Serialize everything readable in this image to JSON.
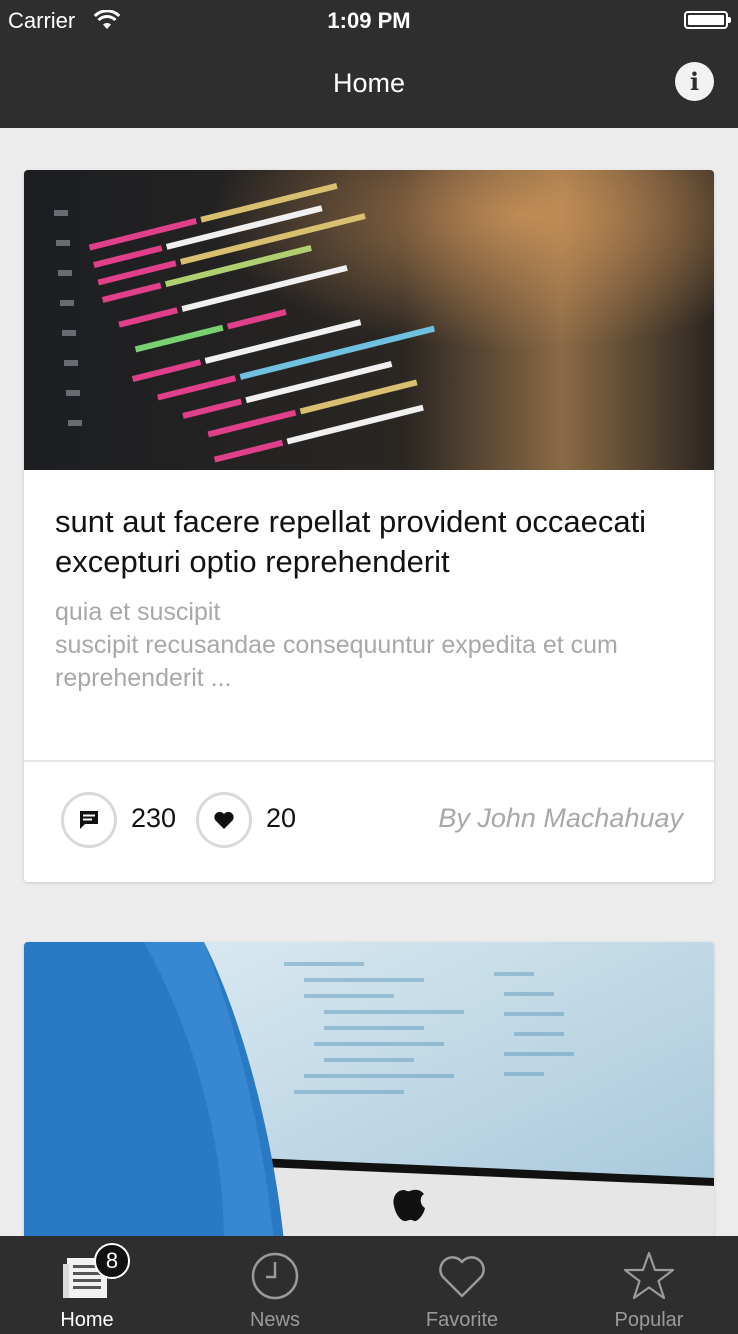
{
  "status_bar": {
    "carrier": "Carrier",
    "time": "1:09 PM"
  },
  "nav": {
    "title": "Home",
    "info_icon": "info-icon",
    "info_glyph": "i"
  },
  "posts": [
    {
      "title": "sunt aut facere repellat provident occaecati excepturi optio reprehenderit",
      "excerpt_lines": [
        "quia et suscipit",
        "suscipit recusandae consequuntur expedita et cum",
        "reprehenderit ..."
      ],
      "comments": "230",
      "likes": "20",
      "author": "By John Machahuay"
    }
  ],
  "tabs": [
    {
      "label": "Home",
      "icon": "newspaper-icon",
      "badge": "8",
      "active": true
    },
    {
      "label": "News",
      "icon": "clock-icon",
      "active": false
    },
    {
      "label": "Favorite",
      "icon": "heart-icon",
      "active": false
    },
    {
      "label": "Popular",
      "icon": "star-icon",
      "active": false
    }
  ],
  "colors": {
    "bar": "#2e2e2e",
    "background": "#ececec",
    "muted_text": "#a8a8a8"
  }
}
